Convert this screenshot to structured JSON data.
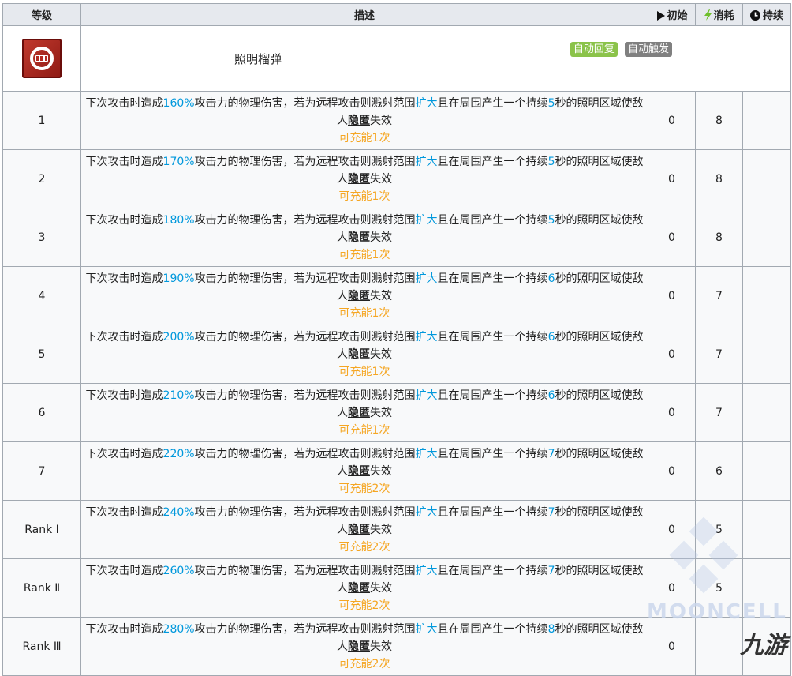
{
  "skill": {
    "name": "照明榴弹",
    "badges": [
      "自动回复",
      "自动触发"
    ],
    "icon": "flare-grenade-icon",
    "icon_color": "#c23a2e"
  },
  "columns": {
    "level": "等级",
    "description": "描述",
    "initial": "初始",
    "cost": "消耗",
    "duration": "持续"
  },
  "colors": {
    "highlight_blue": "#0098dc",
    "charge_orange": "#f5a623",
    "badge_green": "#8bc34a",
    "badge_gray": "#808080",
    "header_bg": "#e6e9ee"
  },
  "desc_parts": {
    "p1": "下次攻击时造成",
    "p2": "攻击力的物理伤害，若为远程攻击则溅射范围",
    "expand": "扩大",
    "p3": "且在周围产生一个持续",
    "p4": "秒的照明区域使敌人",
    "hidden": "隐匿",
    "p5": "失效"
  },
  "rows": [
    {
      "level": "1",
      "pct": "160%",
      "sec": "5",
      "charge": "可充能1次",
      "initial": "0",
      "cost": "8",
      "duration": ""
    },
    {
      "level": "2",
      "pct": "170%",
      "sec": "5",
      "charge": "可充能1次",
      "initial": "0",
      "cost": "8",
      "duration": ""
    },
    {
      "level": "3",
      "pct": "180%",
      "sec": "5",
      "charge": "可充能1次",
      "initial": "0",
      "cost": "8",
      "duration": ""
    },
    {
      "level": "4",
      "pct": "190%",
      "sec": "6",
      "charge": "可充能1次",
      "initial": "0",
      "cost": "7",
      "duration": ""
    },
    {
      "level": "5",
      "pct": "200%",
      "sec": "6",
      "charge": "可充能1次",
      "initial": "0",
      "cost": "7",
      "duration": ""
    },
    {
      "level": "6",
      "pct": "210%",
      "sec": "6",
      "charge": "可充能1次",
      "initial": "0",
      "cost": "7",
      "duration": ""
    },
    {
      "level": "7",
      "pct": "220%",
      "sec": "7",
      "charge": "可充能2次",
      "initial": "0",
      "cost": "6",
      "duration": ""
    },
    {
      "level": "Rank Ⅰ",
      "pct": "240%",
      "sec": "7",
      "charge": "可充能2次",
      "initial": "0",
      "cost": "5",
      "duration": ""
    },
    {
      "level": "Rank Ⅱ",
      "pct": "260%",
      "sec": "7",
      "charge": "可充能2次",
      "initial": "0",
      "cost": "5",
      "duration": ""
    },
    {
      "level": "Rank Ⅲ",
      "pct": "280%",
      "sec": "8",
      "charge": "可充能2次",
      "initial": "0",
      "cost": "",
      "duration": ""
    }
  ],
  "watermark": {
    "text": "MOONCELL",
    "logo": "九游"
  }
}
